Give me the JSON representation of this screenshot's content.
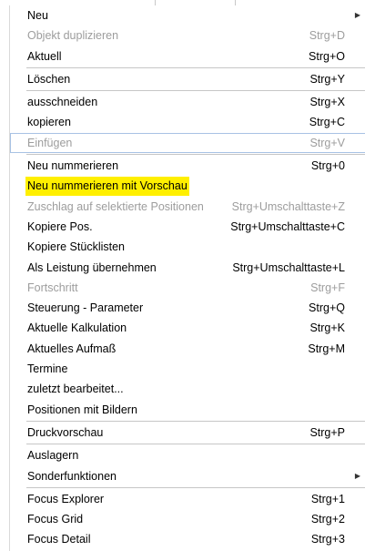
{
  "menu": {
    "items": [
      {
        "label": "Neu",
        "shortcut": "",
        "submenu": true,
        "disabled": false,
        "sep_after": false
      },
      {
        "label": "Objekt duplizieren",
        "shortcut": "Strg+D",
        "disabled": true,
        "sep_after": false
      },
      {
        "label": "Aktuell",
        "shortcut": "Strg+O",
        "disabled": false,
        "sep_after": true
      },
      {
        "label": "Löschen",
        "shortcut": "Strg+Y",
        "disabled": false,
        "sep_after": true
      },
      {
        "label": "ausschneiden",
        "shortcut": "Strg+X",
        "disabled": false,
        "sep_after": false
      },
      {
        "label": "kopieren",
        "shortcut": "Strg+C",
        "disabled": false,
        "sep_after": false
      },
      {
        "label": "Einfügen",
        "shortcut": "Strg+V",
        "disabled": true,
        "focused": true,
        "sep_after": true
      },
      {
        "label": "Neu nummerieren",
        "shortcut": "Strg+0",
        "disabled": false,
        "sep_after": false
      },
      {
        "label": "Neu nummerieren mit Vorschau",
        "shortcut": "",
        "highlight": true,
        "disabled": false,
        "sep_after": false
      },
      {
        "label": "Zuschlag auf selektierte Positionen",
        "shortcut": "Strg+Umschalttaste+Z",
        "disabled": true,
        "sep_after": false
      },
      {
        "label": "Kopiere Pos.",
        "shortcut": "Strg+Umschalttaste+C",
        "disabled": false,
        "sep_after": false
      },
      {
        "label": "Kopiere Stücklisten",
        "shortcut": "",
        "disabled": false,
        "sep_after": false
      },
      {
        "label": "Als Leistung übernehmen",
        "shortcut": "Strg+Umschalttaste+L",
        "disabled": false,
        "sep_after": false
      },
      {
        "label": "Fortschritt",
        "shortcut": "Strg+F",
        "disabled": true,
        "sep_after": false
      },
      {
        "label": "Steuerung - Parameter",
        "shortcut": "Strg+Q",
        "disabled": false,
        "sep_after": false
      },
      {
        "label": "Aktuelle Kalkulation",
        "shortcut": "Strg+K",
        "disabled": false,
        "sep_after": false
      },
      {
        "label": "Aktuelles Aufmaß",
        "shortcut": "Strg+M",
        "disabled": false,
        "sep_after": false
      },
      {
        "label": "Termine",
        "shortcut": "",
        "disabled": false,
        "sep_after": false
      },
      {
        "label": "zuletzt bearbeitet...",
        "shortcut": "",
        "disabled": false,
        "sep_after": false
      },
      {
        "label": "Positionen mit Bildern",
        "shortcut": "",
        "disabled": false,
        "sep_after": true
      },
      {
        "label": "Druckvorschau",
        "shortcut": "Strg+P",
        "disabled": false,
        "sep_after": true
      },
      {
        "label": "Auslagern",
        "shortcut": "",
        "disabled": false,
        "sep_after": false
      },
      {
        "label": "Sonderfunktionen",
        "shortcut": "",
        "submenu": true,
        "disabled": false,
        "sep_after": true
      },
      {
        "label": "Focus Explorer",
        "shortcut": "Strg+1",
        "disabled": false,
        "sep_after": false
      },
      {
        "label": "Focus Grid",
        "shortcut": "Strg+2",
        "disabled": false,
        "sep_after": false
      },
      {
        "label": "Focus Detail",
        "shortcut": "Strg+3",
        "disabled": false,
        "sep_after": false
      }
    ],
    "submenu_arrow": "▶",
    "highlight_color": "#ffef00",
    "disabled_color": "#9d9d9d"
  }
}
